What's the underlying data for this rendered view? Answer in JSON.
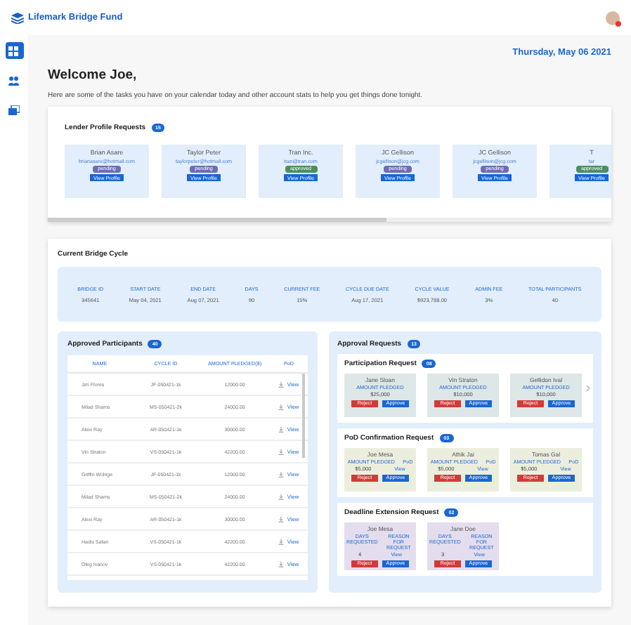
{
  "header": {
    "brand": "Lifemark Bridge Fund"
  },
  "sidebar": {
    "items": [
      {
        "selected": true
      },
      {
        "selected": false
      },
      {
        "selected": false
      }
    ]
  },
  "date": "Thursday, May 06 2021",
  "welcome": {
    "title": "Welcome Joe,",
    "subtitle": "Here are some of the tasks you have on your calendar today and other account stats to help you get things done tonight."
  },
  "lender_requests": {
    "title": "Lender Profile Requests",
    "count": "15",
    "cards": [
      {
        "name": "Brian Asare",
        "email": "brianasare@hotmail.com",
        "status": "pending",
        "button": "View Profile"
      },
      {
        "name": "Taylor Peter",
        "email": "taylorpeter@hotmail.com",
        "status": "pending",
        "button": "View Profile"
      },
      {
        "name": "Tran Inc.",
        "email": "tran@tran.com",
        "status": "approved",
        "button": "View Profile"
      },
      {
        "name": "JC Gellison",
        "email": "jcgellison@jcg.com",
        "status": "pending",
        "button": "View Profile"
      },
      {
        "name": "JC Gellison",
        "email": "jcgellison@jcg.com",
        "status": "pending",
        "button": "View Profile"
      },
      {
        "name": "T",
        "email": "tar",
        "status": "approved",
        "button": "View Profile"
      }
    ]
  },
  "bridge_cycle": {
    "title": "Current Bridge Cycle",
    "stats": [
      {
        "label": "BRIDGE ID",
        "value": "345641"
      },
      {
        "label": "START DATE",
        "value": "May 04, 2021"
      },
      {
        "label": "END DATE",
        "value": "Aug 07, 2021"
      },
      {
        "label": "DAYS",
        "value": "90"
      },
      {
        "label": "CURRENT FEE",
        "value": "15%"
      },
      {
        "label": "CYCLE DUE DATE",
        "value": "Aug 17, 2021"
      },
      {
        "label": "CYCLE VALUE",
        "value": "$923,788.00"
      },
      {
        "label": "ADMIN FEE",
        "value": "3%"
      },
      {
        "label": "TOTAL PARTICIPANTS",
        "value": "40"
      }
    ]
  },
  "approved_participants": {
    "title": "Approved Participants",
    "count": "40",
    "columns": [
      "NAME",
      "CYCLE ID",
      "AMOUNT PLEDGED($)",
      "PoD"
    ],
    "rows": [
      [
        "Jim Flores",
        "JF-050421-1k",
        "12000.00",
        "View"
      ],
      [
        "Milad Shams",
        "MS-050421-2k",
        "24000.00",
        "View"
      ],
      [
        "Alexi Ray",
        "AR-050421-1k",
        "30000.00",
        "View"
      ],
      [
        "Vin Straton",
        "VS-050421-1k",
        "42200.00",
        "View"
      ],
      [
        "Griffin Wolrige",
        "JF-050421-1k",
        "12000.00",
        "View"
      ],
      [
        "Milad Shams",
        "MS-050421-2k",
        "24000.00",
        "View"
      ],
      [
        "Alexi Ray",
        "AR-050421-1k",
        "30000.00",
        "View"
      ],
      [
        "Hadis Safari",
        "VS-050421-1k",
        "42200.00",
        "View"
      ],
      [
        "Oleg Ivanov",
        "VS-050421-1k",
        "42200.00",
        "View"
      ]
    ]
  },
  "approval_requests": {
    "title": "Approval Requests",
    "count": "13",
    "sections": [
      {
        "kind": "participation",
        "title": "Participation Request",
        "count": "08",
        "cards": [
          {
            "name": "Jane Sloan",
            "label": "AMOUNT PLEDGED",
            "value": "$25,000",
            "reject": "Reject",
            "approve": "Approve"
          },
          {
            "name": "Vin Straton",
            "label": "AMOUNT PLEDGED",
            "value": "$10,000",
            "reject": "Reject",
            "approve": "Approve"
          },
          {
            "name": "Gellidon Ival",
            "label": "AMOUNT PLEDGED",
            "value": "$10,000",
            "reject": "Reject",
            "approve": "Approve"
          }
        ]
      },
      {
        "kind": "pod",
        "title": "PoD Confirmation Request",
        "count": "03",
        "cards": [
          {
            "name": "Joe Mesa",
            "label": "AMOUNT PLEDGED",
            "value": "$5,000",
            "label2": "PoD",
            "value2": "View",
            "reject": "Reject",
            "approve": "Approve"
          },
          {
            "name": "Athik Jai",
            "label": "AMOUNT PLEDGED",
            "value": "$5,000",
            "label2": "PoD",
            "value2": "View",
            "reject": "Reject",
            "approve": "Approve"
          },
          {
            "name": "Tomas Gal",
            "label": "AMOUNT PLEDGED",
            "value": "$5,000",
            "label2": "PoD",
            "value2": "View",
            "reject": "Reject",
            "approve": "Approve"
          }
        ]
      },
      {
        "kind": "deadline",
        "title": "Deadline Extension Request",
        "count": "02",
        "cards": [
          {
            "name": "Joe Mesa",
            "label": "DAYS REQUESTED",
            "value": "4",
            "label2": "REASON FOR REQUEST",
            "value2": "View",
            "reject": "Reject",
            "approve": "Approve"
          },
          {
            "name": "Jane Doe",
            "label": "DAYS REQUESTED",
            "value": "3",
            "label2": "REASON FOR REQUEST",
            "value2": "View",
            "reject": "Reject",
            "approve": "Approve"
          }
        ]
      }
    ]
  }
}
